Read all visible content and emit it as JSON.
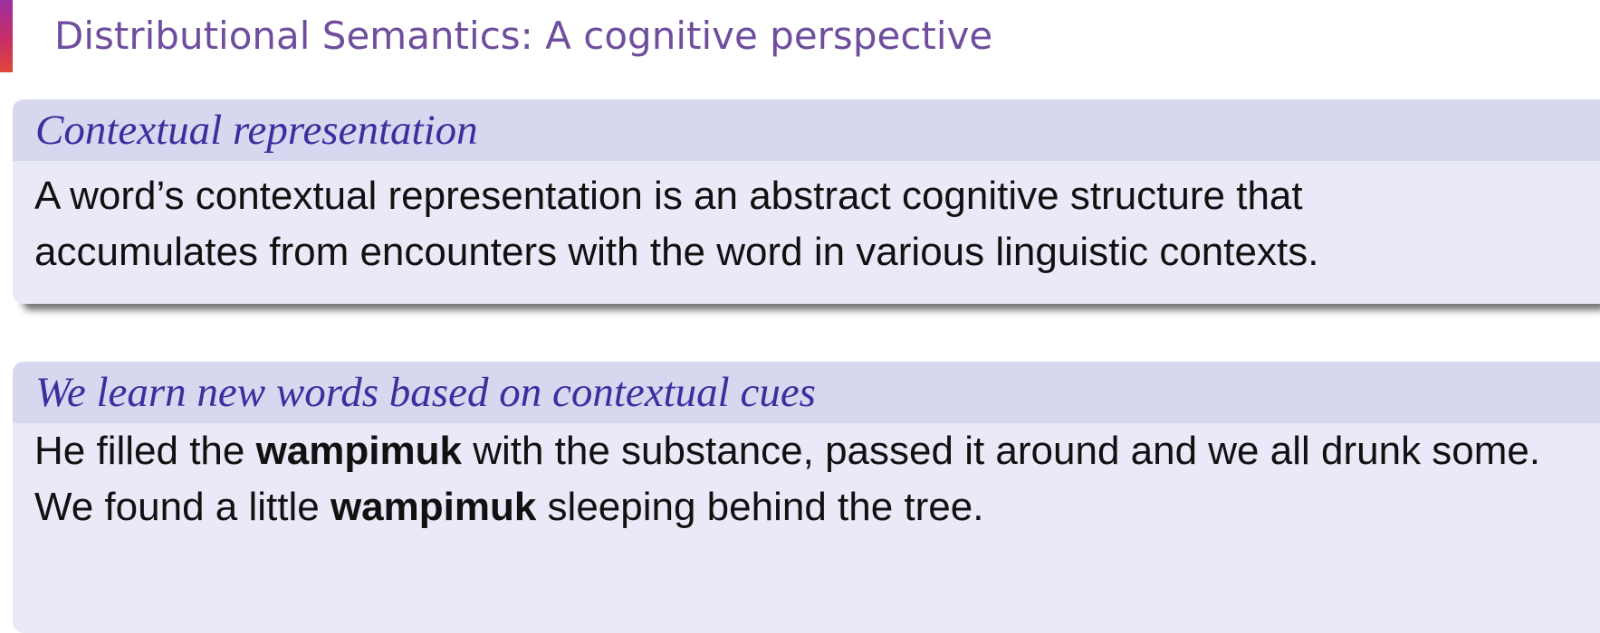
{
  "slide": {
    "title": "Distributional Semantics: A cognitive perspective"
  },
  "blocks": [
    {
      "title": "Contextual representation",
      "lines": [
        "A word’s contextual representation is an abstract cognitive structure that",
        "accumulates from encounters with the word in various linguistic contexts."
      ]
    },
    {
      "title": "We learn new words based on contextual cues",
      "sentence1": {
        "before": "He filled the ",
        "bold": "wampimuk",
        "after": " with the substance, passed it around and we all drunk some."
      },
      "sentence2": {
        "before": "We found a little ",
        "bold": "wampimuk",
        "after": " sleeping behind the tree."
      }
    }
  ],
  "colors": {
    "title": "#6f4e9e",
    "block_title": "#3a2f9e",
    "block_header_bg": "#d7d7ef",
    "block_body_bg": "#e9e9f7",
    "accent_top": "#9b2fa0",
    "accent_bottom": "#e0473a"
  }
}
